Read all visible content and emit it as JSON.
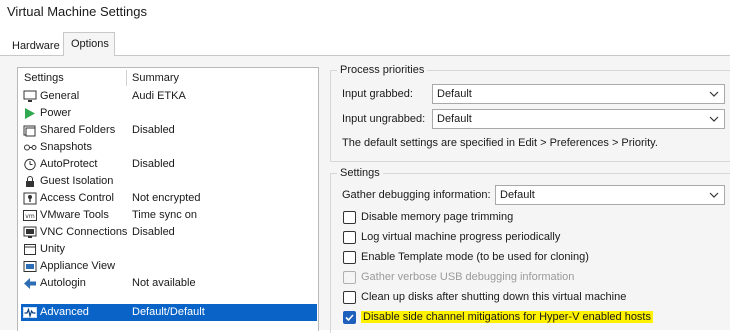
{
  "window": {
    "title": "Virtual Machine Settings"
  },
  "tabs": [
    {
      "label": "Hardware"
    },
    {
      "label": "Options"
    }
  ],
  "list": {
    "headers": {
      "settings": "Settings",
      "summary": "Summary"
    },
    "items": [
      {
        "icon": "monitor-icon",
        "name": "General",
        "summary": "Audi ETKA"
      },
      {
        "icon": "play-icon",
        "name": "Power",
        "summary": ""
      },
      {
        "icon": "shared-folder-icon",
        "name": "Shared Folders",
        "summary": "Disabled"
      },
      {
        "icon": "snapshot-icon",
        "name": "Snapshots",
        "summary": ""
      },
      {
        "icon": "autoprotect-icon",
        "name": "AutoProtect",
        "summary": "Disabled"
      },
      {
        "icon": "lock-icon",
        "name": "Guest Isolation",
        "summary": ""
      },
      {
        "icon": "access-control-icon",
        "name": "Access Control",
        "summary": "Not encrypted"
      },
      {
        "icon": "vmware-tools-icon",
        "name": "VMware Tools",
        "summary": "Time sync on"
      },
      {
        "icon": "vnc-icon",
        "name": "VNC Connections",
        "summary": "Disabled"
      },
      {
        "icon": "unity-icon",
        "name": "Unity",
        "summary": ""
      },
      {
        "icon": "appliance-icon",
        "name": "Appliance View",
        "summary": ""
      },
      {
        "icon": "autologin-icon",
        "name": "Autologin",
        "summary": "Not available"
      },
      {
        "icon": "advanced-icon",
        "name": "Advanced",
        "summary": "Default/Default"
      }
    ],
    "selected_index": 12
  },
  "process_priorities": {
    "title": "Process priorities",
    "grabbed_label": "Input grabbed:",
    "grabbed_value": "Default",
    "ungrabbed_label": "Input ungrabbed:",
    "ungrabbed_value": "Default",
    "note": "The default settings are specified in Edit > Preferences > Priority."
  },
  "settings": {
    "title": "Settings",
    "debug_label": "Gather debugging information:",
    "debug_value": "Default",
    "checkboxes": [
      {
        "label": "Disable memory page trimming",
        "checked": false,
        "enabled": true
      },
      {
        "label": "Log virtual machine progress periodically",
        "checked": false,
        "enabled": true
      },
      {
        "label": "Enable Template mode (to be used for cloning)",
        "checked": false,
        "enabled": true
      },
      {
        "label": "Gather verbose USB debugging information",
        "checked": false,
        "enabled": false
      },
      {
        "label": "Clean up disks after shutting down this virtual machine",
        "checked": false,
        "enabled": true
      },
      {
        "label": "Disable side channel mitigations for Hyper-V enabled hosts",
        "checked": true,
        "enabled": true,
        "highlight": "#fff200"
      }
    ]
  },
  "colors": {
    "selection": "#0a64c8",
    "highlight": "#fff200",
    "checkbox_checked": "#1d5fbd"
  }
}
